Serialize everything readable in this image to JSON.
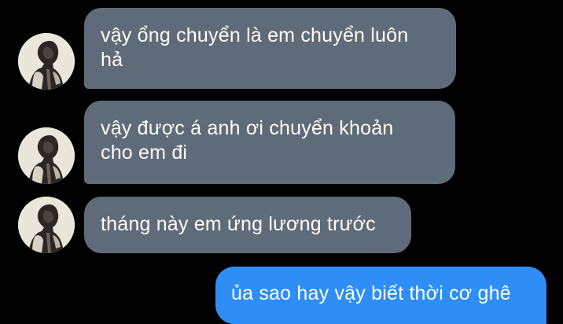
{
  "messages": [
    {
      "direction": "incoming",
      "lines": [
        "vậy ổng chuyển là em chuyển luôn",
        "hả"
      ]
    },
    {
      "direction": "incoming",
      "lines": [
        "vậy được á anh ơi chuyển khoản",
        "cho em đi"
      ]
    },
    {
      "direction": "incoming",
      "lines": [
        "tháng này em ứng lương trước"
      ]
    },
    {
      "direction": "outgoing",
      "lines": [
        "ủa sao hay vậy biết thời cơ ghê"
      ]
    }
  ],
  "colors": {
    "background": "#000000",
    "incoming_bubble": "#5f6b78",
    "outgoing_bubble": "#2f8ef5",
    "text": "#ffffff"
  },
  "icons": {
    "avatar": "user-avatar-photo"
  }
}
